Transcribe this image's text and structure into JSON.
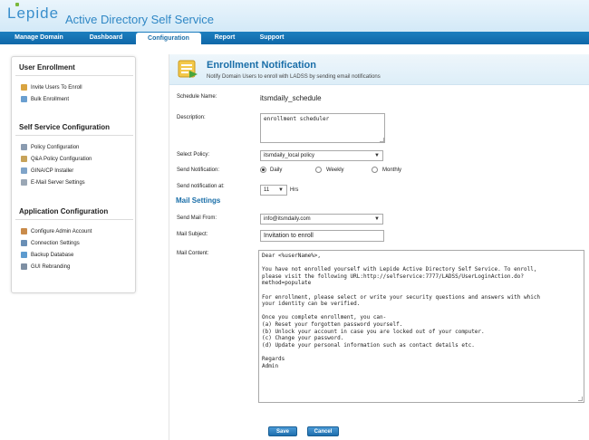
{
  "app": {
    "logo": "Lepide",
    "title": "Active Directory Self Service"
  },
  "nav": {
    "items": [
      {
        "label": "Manage Domain"
      },
      {
        "label": "Dashboard"
      },
      {
        "label": "Configuration"
      },
      {
        "label": "Report"
      },
      {
        "label": "Support"
      }
    ],
    "active": "Configuration"
  },
  "sidebar": {
    "sections": [
      {
        "title": "User Enrollment",
        "items": [
          {
            "label": "Invite Users To Enroll",
            "icon": "envelope-icon"
          },
          {
            "label": "Bulk Enrollment",
            "icon": "users-icon"
          }
        ]
      },
      {
        "title": "Self Service Configuration",
        "items": [
          {
            "label": "Policy Configuration",
            "icon": "policy-icon"
          },
          {
            "label": "Q&A Policy Configuration",
            "icon": "qa-icon"
          },
          {
            "label": "GINA/CP Installer",
            "icon": "installer-icon"
          },
          {
            "label": "E-Mail Server Settings",
            "icon": "mail-server-icon"
          }
        ]
      },
      {
        "title": "Application Configuration",
        "items": [
          {
            "label": "Configure Admin Account",
            "icon": "admin-icon"
          },
          {
            "label": "Connection Settings",
            "icon": "connection-icon"
          },
          {
            "label": "Backup Database",
            "icon": "database-icon"
          },
          {
            "label": "GUI Rebranding",
            "icon": "rebranding-icon"
          }
        ]
      }
    ]
  },
  "main": {
    "title": "Enrollment Notification",
    "subtitle": "Notify Domain Users to enroll with LADSS by sending email notifications",
    "icon": "notification-icon"
  },
  "form": {
    "schedule_name_label": "Schedule Name:",
    "schedule_name_value": "itsmdaily_schedule",
    "description_label": "Description:",
    "description_value": "enrollment scheduler",
    "select_policy_label": "Select Policy:",
    "select_policy_value": "itsmdaily_local policy",
    "send_notification_label": "Send Notification:",
    "frequency_options": [
      "Daily",
      "Weekly",
      "Monthly"
    ],
    "frequency_selected": "Daily",
    "send_at_label": "Send notification at:",
    "send_at_value": "11",
    "send_at_unit": "Hrs",
    "mail_settings_heading": "Mail Settings",
    "send_from_label": "Send Mail From:",
    "send_from_value": "info@itsmdaily.com",
    "subject_label": "Mail Subject:",
    "subject_value": "Invitation to enroll",
    "content_label": "Mail Content:",
    "content_value": "Dear <%userName%>,\n\nYou have not enrolled yourself with Lepide Active Directory Self Service. To enroll,\nplease visit the following URL:http://selfservice:7777/LADSS/UserLoginAction.do?\nmethod=populate\n\nFor enrollment, please select or write your security questions and answers with which\nyour identity can be verified.\n\nOnce you complete enrollment, you can-\n(a) Reset your forgotten password yourself.\n(b) Unlock your account in case you are locked out of your computer.\n(c) Change your password.\n(d) Update your personal information such as contact details etc.\n\nRegards\nAdmin"
  },
  "buttons": {
    "save": "Save",
    "cancel": "Cancel"
  },
  "colors": {
    "accent": "#1a6ea8",
    "nav_bg": "#1570b3",
    "logo_green": "#7ab83b"
  }
}
